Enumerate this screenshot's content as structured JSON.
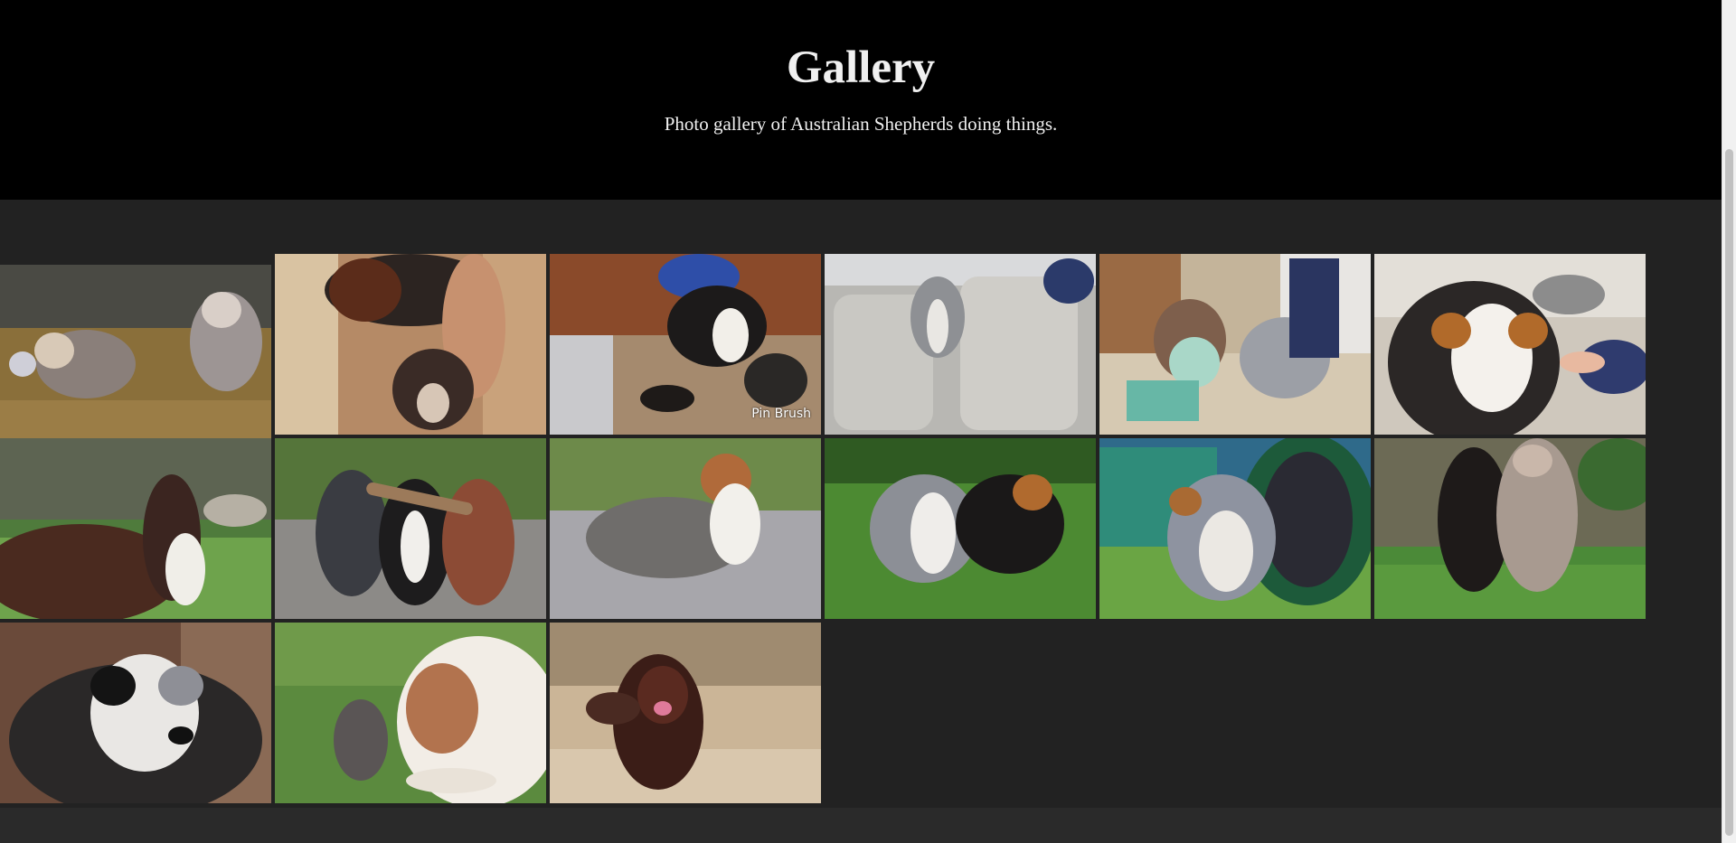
{
  "header": {
    "title": "Gallery",
    "subtitle": "Photo gallery of Australian Shepherds doing things."
  },
  "gallery": {
    "photos": [
      {
        "subject": "two merle puppies running"
      },
      {
        "subject": "woman bathing a dog"
      },
      {
        "subject": "person brushing a dog",
        "caption": "Pin Brush"
      },
      {
        "subject": "dog peeking over car seat"
      },
      {
        "subject": "toddler sharing a bowl with a dog"
      },
      {
        "subject": "dog with a hair dryer"
      },
      {
        "subject": "wet dog under sprinkler"
      },
      {
        "subject": "three puppies carrying a stick"
      },
      {
        "subject": "merle puppy standing on path"
      },
      {
        "subject": "two dogs running in grass"
      },
      {
        "subject": "dog exiting agility tunnel"
      },
      {
        "subject": "two dogs playing upright"
      },
      {
        "subject": "fluffy merle dog portrait"
      },
      {
        "subject": "dog meeting a squirrel"
      },
      {
        "subject": "red tri dog running"
      }
    ]
  },
  "colors": {
    "header_bg": "#000000",
    "page_bg": "#222222",
    "header_text": "#f0f0f0"
  }
}
